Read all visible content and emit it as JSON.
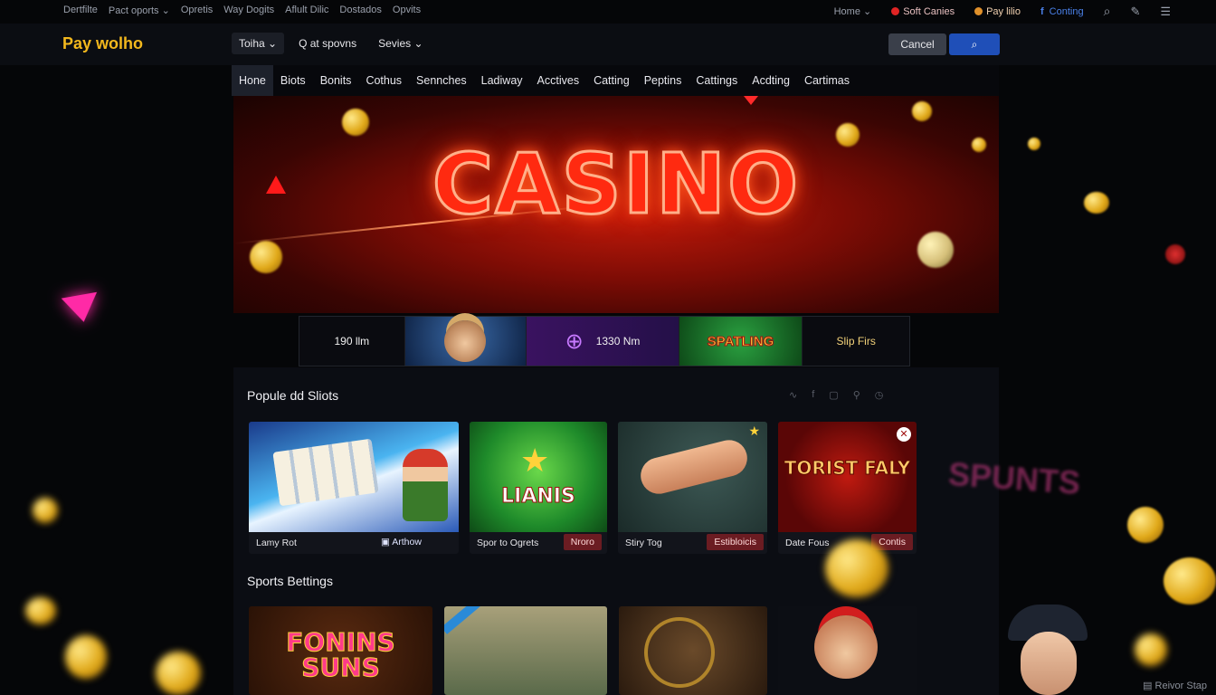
{
  "topbar": {
    "left_links": [
      "Dertfilte",
      "Pact oports",
      "Opretis",
      "Way Dogits",
      "Aflult Dilic",
      "Dostados",
      "Opvits"
    ],
    "right_links": {
      "home": "Home",
      "soft_games": "Soft Canies",
      "pay": "Pay lilio",
      "coming": "Conting"
    }
  },
  "header": {
    "logo": "Pay wolho",
    "nav": [
      "Toiha",
      "Q at spovns",
      "Sevies"
    ],
    "cancel_label": "Cancel"
  },
  "tabs": [
    "Hone",
    "Biots",
    "Bonits",
    "Cothus",
    "Sennches",
    "Ladiway",
    "Acctives",
    "Catting",
    "Peptins",
    "Cattings",
    "Acdting",
    "Cartimas"
  ],
  "hero": {
    "title": "CASINO"
  },
  "strip": [
    "190 llm",
    "",
    "1330 Nm",
    "SPATLING",
    "Slip Firs"
  ],
  "popular": {
    "title": "Popule dd Sliots",
    "cards": [
      {
        "caption": "Lamy Rot",
        "tag": "Arthow"
      },
      {
        "caption": "Spor to Ogrets",
        "tag": "Nroro",
        "art": "LIANIS"
      },
      {
        "caption": "Stiry Tog",
        "tag": "Estibloicis"
      },
      {
        "caption": "Date Fous",
        "tag": "Contis",
        "art": "TORIST FALY"
      }
    ],
    "ghost_text": "SPUNTS"
  },
  "sports": {
    "title": "Sports Bettings",
    "cards": [
      {
        "art": "FONINS SUNS"
      },
      {
        "art": ""
      },
      {
        "art": ""
      },
      {
        "art": ""
      }
    ]
  },
  "footer_note": "Reivor Stap",
  "colors": {
    "brand": "#f3b81d",
    "primary": "#1f4fb8",
    "hero_red": "#ff2a10",
    "tag_bg": "#6b1c22"
  }
}
